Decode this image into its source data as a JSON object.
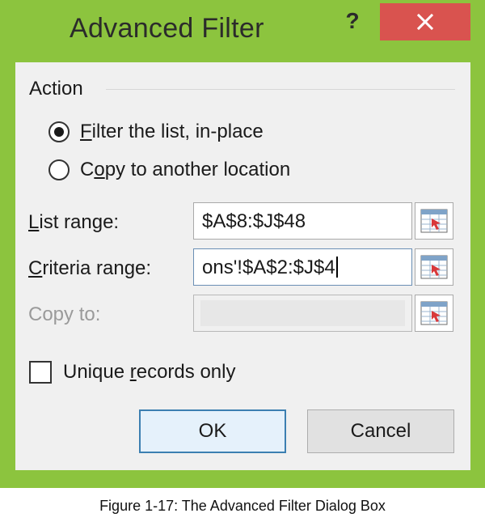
{
  "dialog": {
    "title": "Advanced Filter",
    "help_label": "?",
    "close_icon": "close-icon"
  },
  "action": {
    "group_label": "Action",
    "options": [
      {
        "prefix": "",
        "accel": "F",
        "rest": "ilter the list, in-place",
        "selected": true
      },
      {
        "prefix": "C",
        "accel": "o",
        "rest": "py to another location",
        "selected": false
      }
    ]
  },
  "fields": {
    "list_range": {
      "prefix": "",
      "accel": "L",
      "rest": "ist range:",
      "value": "$A$8:$J$48"
    },
    "criteria_range": {
      "prefix": "",
      "accel": "C",
      "rest": "riteria range:",
      "value": "ons'!$A$2:$J$4"
    },
    "copy_to": {
      "label": "Copy to:",
      "value": "",
      "enabled": false
    }
  },
  "unique": {
    "prefix": "Unique ",
    "accel": "r",
    "rest": "ecords only",
    "checked": false
  },
  "buttons": {
    "ok": "OK",
    "cancel": "Cancel"
  },
  "caption": "Figure 1-17: The Advanced Filter Dialog Box",
  "colors": {
    "titlebar": "#8cc43e",
    "close": "#d9534f",
    "client": "#f0f0f0",
    "default_border": "#3c7fb1"
  }
}
